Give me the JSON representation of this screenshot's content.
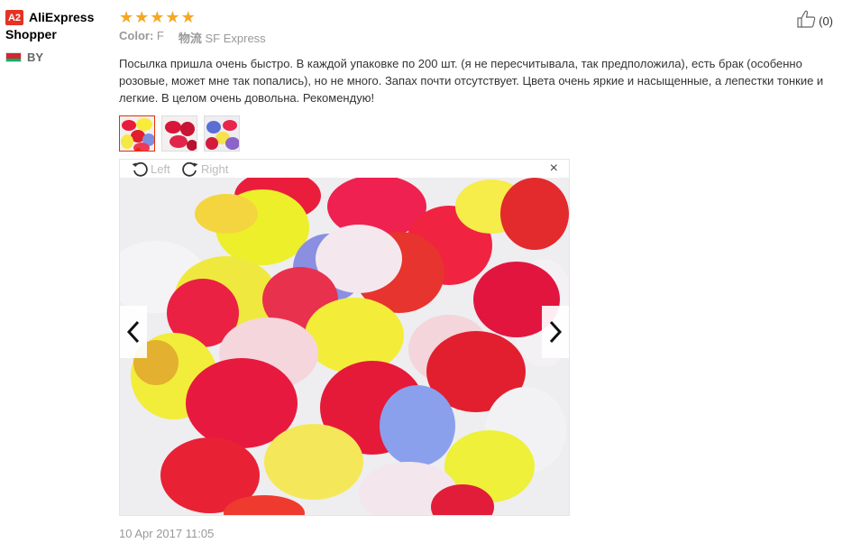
{
  "user": {
    "badge": "A2",
    "name_line1": "AliExpress",
    "name_line2": "Shopper",
    "country": "BY"
  },
  "review": {
    "rating": 5,
    "color_label": "Color:",
    "color_value": "F",
    "shipping_label": "物流",
    "shipping_value": "SF Express",
    "text": "Посылка пришла очень быстро. В каждой упаковке по 200 шт. (я не пересчитывала, так предположила), есть брак (особенно розовые, может мне так попались), но не много. Запах почти отсутствует. Цвета очень яркие и насыщенные, а лепестки тонкие и легкие. В целом очень довольна. Рекомендую!",
    "likes": "(0)",
    "date": "10 Apr 2017 11:05"
  },
  "viewer": {
    "rotate_left": "Left",
    "rotate_right": "Right",
    "close": "×",
    "thumbnail_count": 3,
    "active_thumbnail": 1
  },
  "colors": {
    "accent": "#e62e04",
    "star": "#f5a623",
    "badge": "#e43225",
    "muted": "#999999"
  }
}
